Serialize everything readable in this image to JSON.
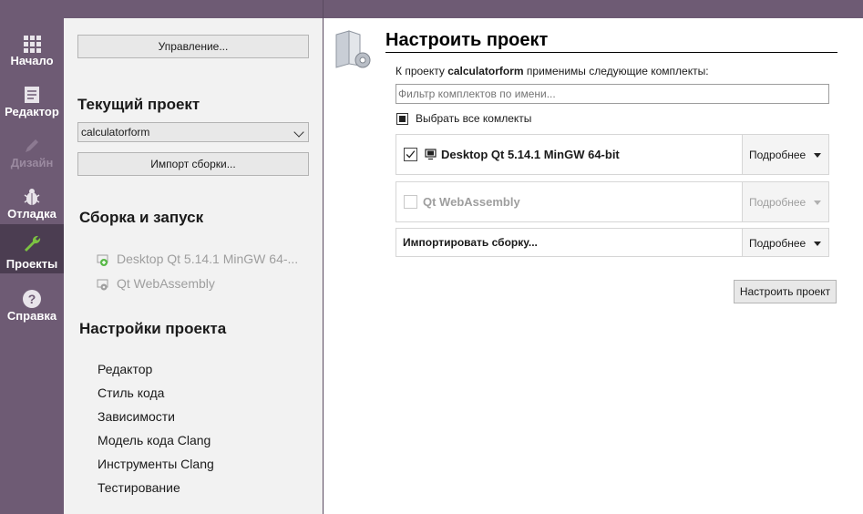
{
  "modes": [
    {
      "label": "Начало",
      "icon": "grid-icon"
    },
    {
      "label": "Редактор",
      "icon": "document-icon"
    },
    {
      "label": "Дизайн",
      "icon": "pencil-icon"
    },
    {
      "label": "Отладка",
      "icon": "bug-icon"
    },
    {
      "label": "Проекты",
      "icon": "wrench-icon"
    },
    {
      "label": "Справка",
      "icon": "help-icon"
    }
  ],
  "left": {
    "manage_button": "Управление...",
    "current_project_title": "Текущий проект",
    "current_project_value": "calculatorform",
    "import_build_button": "Импорт сборки...",
    "build_run_title": "Сборка и запуск",
    "kits": [
      {
        "label": "Desktop Qt 5.14.1 MinGW 64-..."
      },
      {
        "label": "Qt  WebAssembly"
      }
    ],
    "project_settings_title": "Настройки проекта",
    "settings": [
      "Редактор",
      "Стиль кода",
      "Зависимости",
      "Модель кода Clang",
      "Инструменты Clang",
      "Тестирование"
    ]
  },
  "right": {
    "title": "Настроить проект",
    "desc_prefix": "К проекту ",
    "desc_project": "calculatorform",
    "desc_suffix": " применимы следующие комплекты:",
    "filter_placeholder": "Фильтр комплектов по имени...",
    "select_all_label": "Выбрать все комлекты",
    "kit_rows": [
      {
        "name": "Desktop Qt 5.14.1 MinGW 64-bit",
        "details": "Подробнее",
        "checked": true
      },
      {
        "name": "Qt  WebAssembly",
        "details": "Подробнее",
        "checked": false
      },
      {
        "name": "Импортировать сборку...",
        "details": "Подробнее"
      }
    ],
    "configure_button": "Настроить проект"
  },
  "colors": {
    "modebar": "#6e5b74",
    "modebar_active": "#4b3d51",
    "accent_green": "#7cc242"
  }
}
